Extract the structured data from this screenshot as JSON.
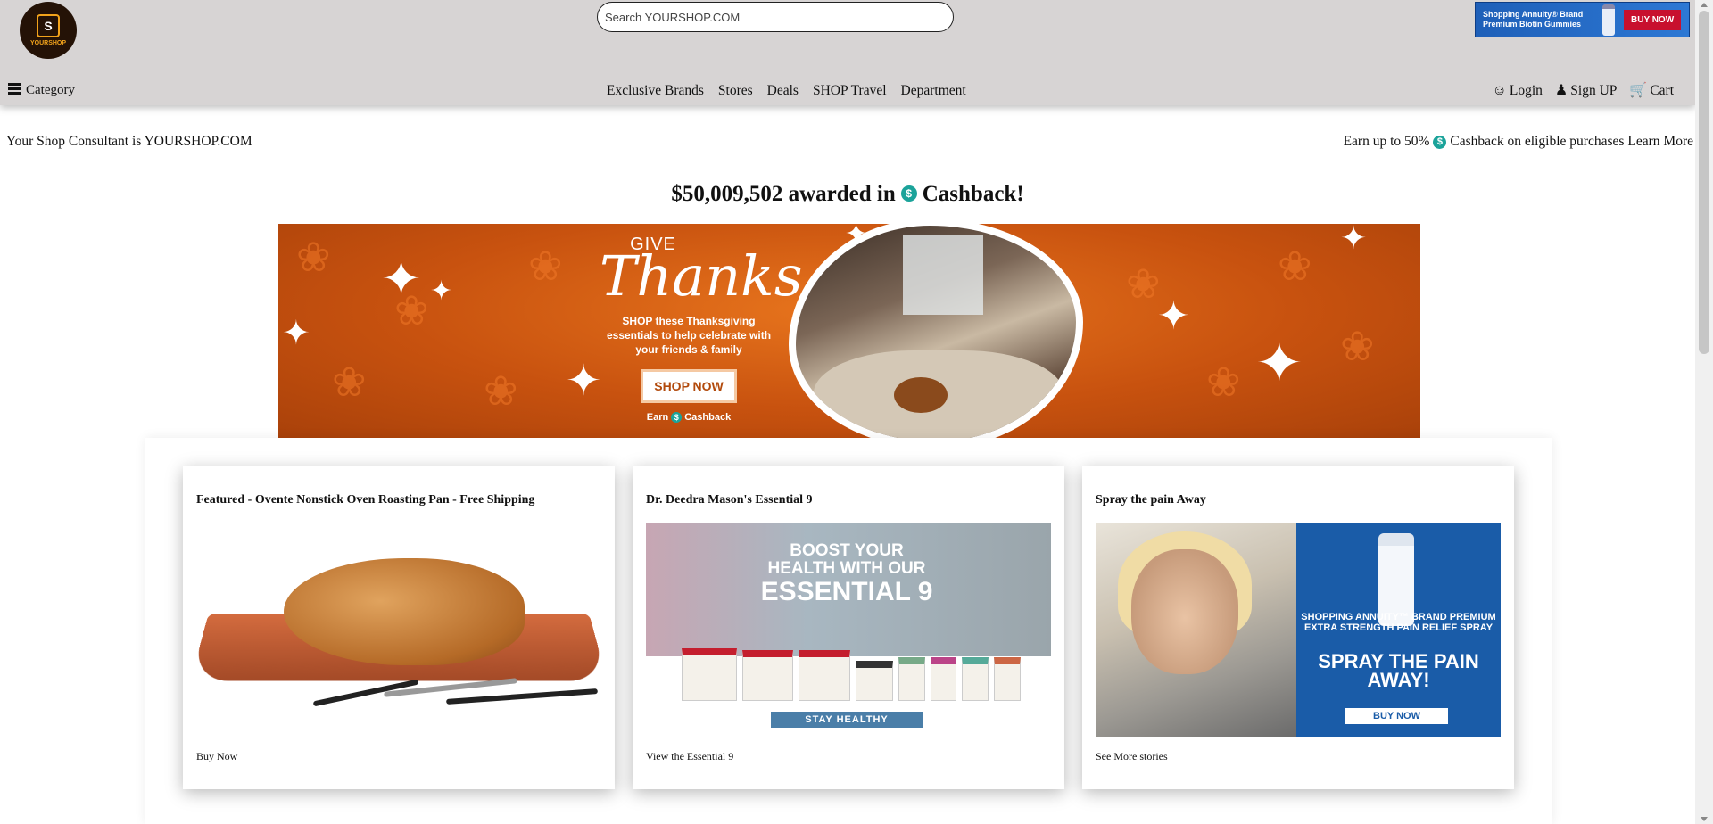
{
  "header": {
    "logo_text": "YOURSHOP",
    "logo_mark": "S",
    "search_placeholder": "Search YOURSHOP.COM",
    "ad": {
      "line1": "Shopping Annuity® Brand",
      "line2": "Premium Biotin Gummies",
      "button": "BUY NOW"
    }
  },
  "nav": {
    "category_label": "Category",
    "main": [
      "Exclusive Brands",
      "Stores",
      "Deals",
      "SHOP Travel",
      "Department"
    ],
    "login": "Login",
    "signup": "Sign UP",
    "cart": "Cart"
  },
  "info": {
    "consultant": "Your Shop Consultant is YOURSHOP.COM",
    "earn_prefix": "Earn up to 50%",
    "earn_suffix": "Cashback on eligible purchases",
    "learn_more": "Learn More",
    "coin_symbol": "$"
  },
  "awarded": {
    "amount_text": "$50,009,502 awarded in",
    "cashback_text": "Cashback!"
  },
  "hero": {
    "give": "GIVE",
    "thanks": "Thanks",
    "sub": "SHOP these Thanksgiving essentials to help celebrate with your friends & family",
    "button": "SHOP NOW",
    "earn": "Earn",
    "cashback": "Cashback"
  },
  "cards": [
    {
      "title": "Featured - Ovente Nonstick Oven Roasting Pan - Free Shipping",
      "link": "Buy Now"
    },
    {
      "title": "Dr. Deedra Mason's Essential 9",
      "link": "View the Essential 9",
      "image": {
        "line1": "BOOST YOUR",
        "line2": "HEALTH WITH OUR",
        "line3": "ESSENTIAL 9",
        "button": "STAY HEALTHY"
      }
    },
    {
      "title": "Spray the pain Away",
      "link": "See More stories",
      "image": {
        "sub": "SHOPPING ANNUITY™ BRAND PREMIUM EXTRA STRENGTH PAIN RELIEF SPRAY",
        "big": "SPRAY THE PAIN AWAY!",
        "button": "BUY NOW"
      }
    }
  ],
  "colors": {
    "header_bg": "#d7d4d4",
    "coin": "#1ba39a",
    "hero_orange": "#c8520f",
    "spray_blue": "#1a5ca8"
  }
}
